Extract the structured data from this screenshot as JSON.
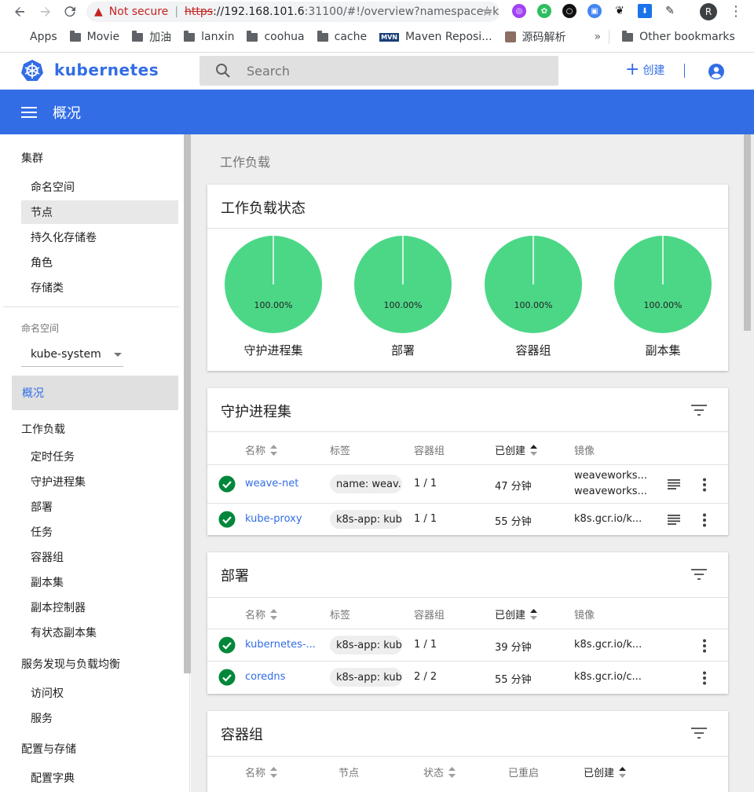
{
  "browser": {
    "not_secure": "Not secure",
    "url_scheme": "https",
    "url_host": "://192.168.101.6",
    "url_rest": ":31100/#!/overview?namespace=k...",
    "profile_initial": "R",
    "bookmarks": [
      "Apps",
      "Movie",
      "加油",
      "lanxin",
      "coohua",
      "cache",
      "Maven Reposi...",
      "源码解析"
    ],
    "bookmarks_more": "»",
    "other_bookmarks": "Other bookmarks"
  },
  "header": {
    "brand": "kubernetes",
    "search_placeholder": "Search",
    "create_label": "创建",
    "brand_color": "#326de6"
  },
  "titlebar": {
    "title": "概况"
  },
  "sidebar": {
    "cluster": "集群",
    "cluster_items": [
      "命名空间",
      "节点",
      "持久化存储卷",
      "角色",
      "存储类"
    ],
    "namespace_label": "命名空间",
    "namespace_value": "kube-system",
    "overview": "概况",
    "workloads": "工作负载",
    "workload_items": [
      "定时任务",
      "守护进程集",
      "部署",
      "任务",
      "容器组",
      "副本集",
      "副本控制器",
      "有状态副本集"
    ],
    "discovery": "服务发现与负载均衡",
    "discovery_items": [
      "访问权",
      "服务"
    ],
    "config": "配置与存储",
    "config_items": [
      "配置字典"
    ]
  },
  "main": {
    "breadcrumb": "工作负载",
    "status_card": {
      "title": "工作负载状态",
      "pies": [
        {
          "label": "守护进程集",
          "pct": "100.00%",
          "value": 100
        },
        {
          "label": "部署",
          "pct": "100.00%",
          "value": 100
        },
        {
          "label": "容器组",
          "pct": "100.00%",
          "value": 100
        },
        {
          "label": "副本集",
          "pct": "100.00%",
          "value": 100
        }
      ],
      "pie_color": "#4cd787"
    },
    "daemonsets": {
      "title": "守护进程集",
      "headers": [
        "名称",
        "标签",
        "容器组",
        "已创建",
        "镜像"
      ],
      "rows": [
        {
          "name": "weave-net",
          "label": "name: weav...",
          "pods": "1 / 1",
          "created": "47 分钟",
          "image1": "weaveworks...",
          "image2": "weaveworks..."
        },
        {
          "name": "kube-proxy",
          "label": "k8s-app: kub...",
          "pods": "1 / 1",
          "created": "55 分钟",
          "image1": "k8s.gcr.io/k...",
          "image2": ""
        }
      ]
    },
    "deployments": {
      "title": "部署",
      "headers": [
        "名称",
        "标签",
        "容器组",
        "已创建",
        "镜像"
      ],
      "rows": [
        {
          "name": "kubernetes-...",
          "label": "k8s-app: kub...",
          "pods": "1 / 1",
          "created": "39 分钟",
          "image1": "k8s.gcr.io/k..."
        },
        {
          "name": "coredns",
          "label": "k8s-app: kub...",
          "pods": "2 / 2",
          "created": "55 分钟",
          "image1": "k8s.gcr.io/c..."
        }
      ]
    },
    "pods": {
      "title": "容器组",
      "headers": [
        "名称",
        "节点",
        "状态",
        "已重启",
        "已创建"
      ]
    }
  }
}
